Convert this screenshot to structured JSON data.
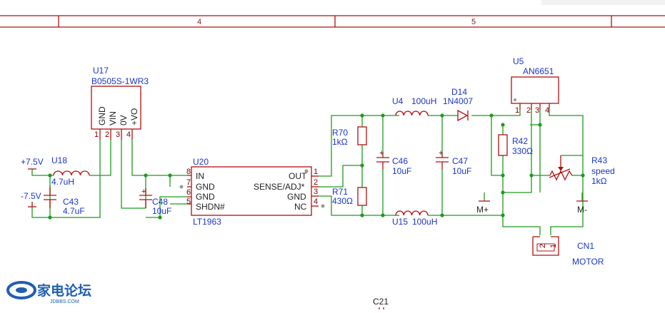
{
  "zones": {
    "z4": "4",
    "z5": "5"
  },
  "parts": {
    "u17": {
      "ref": "U17",
      "value": "B0505S-1WR3",
      "pins": [
        "GND",
        "VIN",
        "0V",
        "+VO"
      ],
      "nums": [
        "1",
        "2",
        "3",
        "4"
      ]
    },
    "u18": {
      "ref": "U18",
      "value": "4.7uH"
    },
    "c43": {
      "ref": "C43",
      "value": "4.7uF"
    },
    "c48": {
      "ref": "C48",
      "value": "10uF"
    },
    "u20": {
      "ref": "U20",
      "value": "LT1963",
      "left_pins": [
        "IN",
        "GND",
        "GND",
        "SHDN#"
      ],
      "left_nums": [
        "8",
        "7",
        "6",
        "5"
      ],
      "right_pins": [
        "OUT",
        "SENSE/ADJ*",
        "GND",
        "NC"
      ],
      "right_nums": [
        "1",
        "2",
        "3",
        "4"
      ]
    },
    "r70": {
      "ref": "R70",
      "value": "1kΩ"
    },
    "r71": {
      "ref": "R71",
      "value": "430Ω"
    },
    "u4": {
      "ref": "U4",
      "value": "100uH"
    },
    "u15": {
      "ref": "U15",
      "value": "100uH"
    },
    "d14": {
      "ref": "D14",
      "value": "1N4007"
    },
    "c46": {
      "ref": "C46",
      "value": "10uF"
    },
    "c47": {
      "ref": "C47",
      "value": "10uF"
    },
    "u5": {
      "ref": "U5",
      "value": "AN6651",
      "nums": [
        "1",
        "2",
        "3",
        "4"
      ]
    },
    "r42": {
      "ref": "R42",
      "value": "330Ω"
    },
    "r43": {
      "ref": "R43",
      "value1": "speed",
      "value2": "1kΩ"
    },
    "cn1": {
      "ref": "CN1",
      "value": "MOTOR",
      "nums": [
        "2",
        "1"
      ]
    },
    "c21": {
      "ref": "C21"
    }
  },
  "nets": {
    "vpos": "+7.5V",
    "vneg": "-7.5V",
    "mplus": "M+",
    "mminus": "M-"
  },
  "plus_sign": "+",
  "watermark": {
    "main": "家电论坛",
    "sub": "JDBBS.COM"
  }
}
